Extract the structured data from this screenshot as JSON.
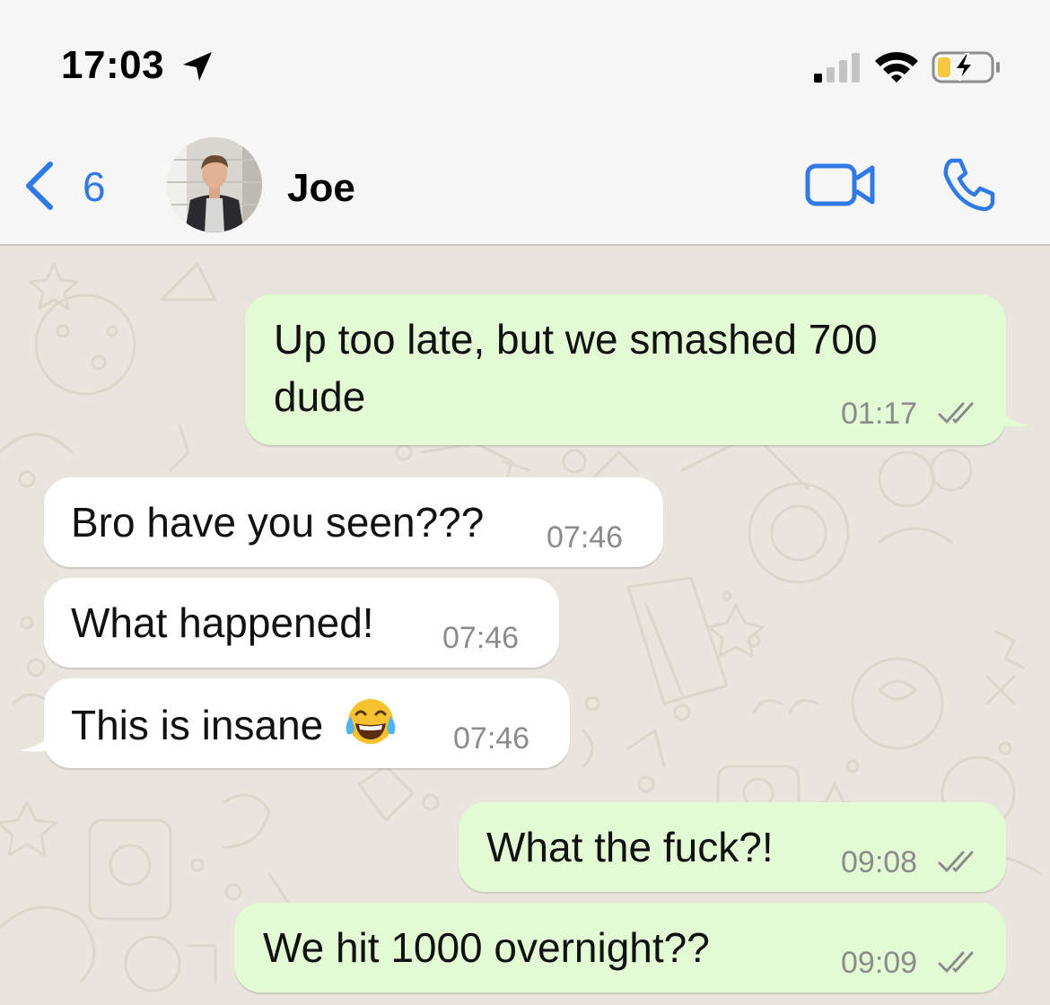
{
  "status_bar": {
    "time": "17:03",
    "location_icon": "location-arrow-icon",
    "signal_icon": "cellular-signal-icon",
    "wifi_icon": "wifi-icon",
    "battery_icon": "battery-charging-icon",
    "battery_color": "#f5c842"
  },
  "header": {
    "back_count": "6",
    "contact_name": "Joe",
    "accent_color": "#2f7ae5",
    "icons": [
      "chevron-left-icon",
      "video-camera-icon",
      "phone-icon"
    ]
  },
  "messages": [
    {
      "direction": "outgoing",
      "lines": [
        "Up too late, but we smashed 700",
        "dude"
      ],
      "time": "01:17",
      "status": "read"
    },
    {
      "direction": "incoming",
      "text": "Bro have you seen???",
      "time": "07:46"
    },
    {
      "direction": "incoming",
      "text": "What happened!",
      "time": "07:46"
    },
    {
      "direction": "incoming",
      "text": "This is insane",
      "emoji": "face-with-tears-of-joy",
      "time": "07:46"
    },
    {
      "direction": "outgoing",
      "text": "What the fuck?!",
      "time": "09:08",
      "status": "read"
    },
    {
      "direction": "outgoing",
      "text": "We hit 1000 overnight??",
      "time": "09:09",
      "status": "read"
    }
  ],
  "colors": {
    "outgoing_bubble": "#e2fbd4",
    "incoming_bubble": "#ffffff",
    "chat_background": "#e9e5dd",
    "timestamp": "#8b8b8b"
  }
}
